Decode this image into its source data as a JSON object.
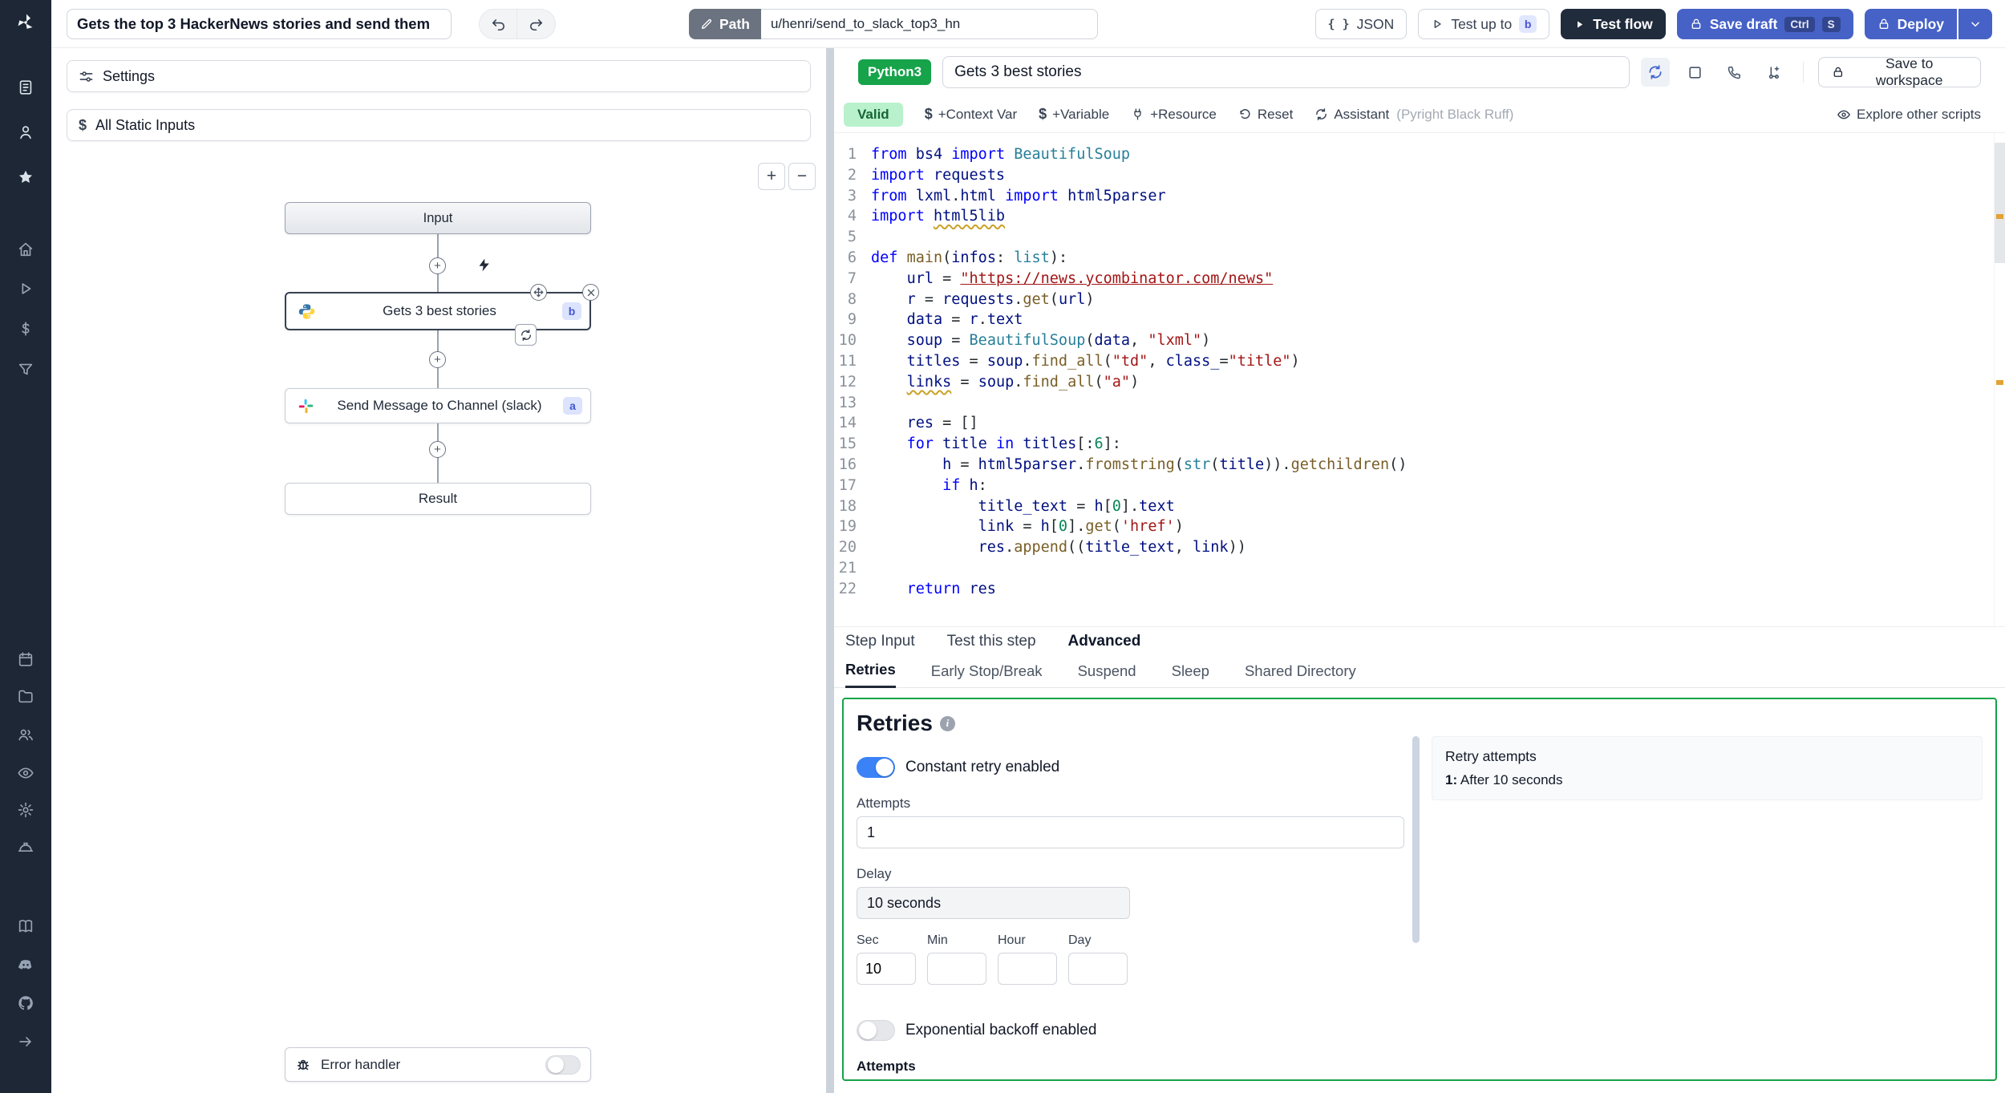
{
  "topbar": {
    "flow_title": "Gets the top 3 HackerNews stories and send them",
    "path_label": "Path",
    "path_value": "u/henri/send_to_slack_top3_hn",
    "json_label": "JSON",
    "test_up_to_label": "Test up to",
    "test_up_to_badge": "b",
    "test_flow_label": "Test flow",
    "save_draft_label": "Save draft",
    "kbd_ctrl": "Ctrl",
    "kbd_s": "S",
    "deploy_label": "Deploy"
  },
  "flow_panel": {
    "settings_label": "Settings",
    "static_inputs_label": "All Static Inputs",
    "zoom_in": "+",
    "zoom_out": "−",
    "nodes": {
      "input_label": "Input",
      "step_b_label": "Gets 3 best stories",
      "step_b_badge": "b",
      "step_a_label": "Send Message to Channel (slack)",
      "step_a_badge": "a",
      "result_label": "Result",
      "error_handler_label": "Error handler"
    }
  },
  "editor": {
    "language_badge": "Python3",
    "step_title": "Gets 3 best stories",
    "save_to_workspace_label": "Save to workspace",
    "validity_badge": "Valid",
    "add_context_var_label": "+Context Var",
    "add_variable_label": "+Variable",
    "add_resource_label": "+Resource",
    "reset_label": "Reset",
    "assistant_label": "Assistant",
    "assistant_detail": "(Pyright Black Ruff)",
    "explore_label": "Explore other scripts",
    "code_lines": [
      "from bs4 import BeautifulSoup",
      "import requests",
      "from lxml.html import html5parser",
      "import html5lib",
      "",
      "def main(infos: list):",
      "    url = \"https://news.ycombinator.com/news\"",
      "    r = requests.get(url)",
      "    data = r.text",
      "    soup = BeautifulSoup(data, \"lxml\")",
      "    titles = soup.find_all(\"td\", class_=\"title\")",
      "    links = soup.find_all(\"a\")",
      "",
      "    res = []",
      "    for title in titles[:6]:",
      "        h = html5parser.fromstring(str(title)).getchildren()",
      "        if h:",
      "            title_text = h[0].text",
      "            link = h[0].get('href')",
      "            res.append((title_text, link))",
      "",
      "    return res"
    ],
    "warnings": [
      {
        "line": 4,
        "token": "html5lib"
      },
      {
        "line": 12,
        "token": "links"
      }
    ]
  },
  "tabs": {
    "main": [
      "Step Input",
      "Test this step",
      "Advanced"
    ],
    "main_active": 2,
    "sub": [
      "Retries",
      "Early Stop/Break",
      "Suspend",
      "Sleep",
      "Shared Directory"
    ],
    "sub_active": 0
  },
  "retries": {
    "heading": "Retries",
    "constant_retry_label": "Constant retry enabled",
    "attempts_label": "Attempts",
    "attempts_value": "1",
    "delay_label": "Delay",
    "delay_value": "10 seconds",
    "sec_label": "Sec",
    "min_label": "Min",
    "hour_label": "Hour",
    "day_label": "Day",
    "sec_value": "10",
    "exponential_label": "Exponential backoff enabled",
    "attempts2_label": "Attempts",
    "summary_title": "Retry attempts",
    "summary_item_prefix": "1:",
    "summary_item_text": "After 10 seconds"
  },
  "colors": {
    "primary_blue": "#4662c6",
    "panel_green": "#16a34a",
    "sidebar_bg": "#1d2736",
    "toggle_blue": "#3b82f6"
  }
}
